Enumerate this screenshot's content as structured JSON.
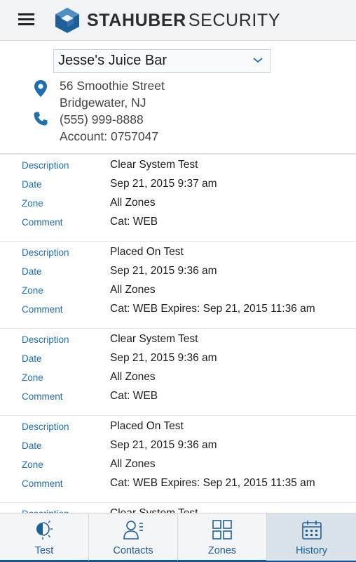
{
  "header": {
    "brand_bold": "STAHUBER",
    "brand_light": "SECURITY",
    "colors": {
      "logo_dark": "#1f5f97",
      "logo_light": "#4f8fc6"
    }
  },
  "account": {
    "site_name": "Jesse's Juice Bar",
    "street": "56 Smoothie Street",
    "city": "Bridgewater, NJ",
    "phone": "(555) 999-8888",
    "account_label": "Account: 0757047"
  },
  "history": {
    "labels": {
      "description": "Description",
      "date": "Date",
      "zone": "Zone",
      "comment": "Comment"
    },
    "records": [
      {
        "description": "Clear System Test",
        "date": "Sep 21, 2015 9:37 am",
        "zone": "All Zones",
        "comment": "Cat: WEB"
      },
      {
        "description": "Placed On Test",
        "date": "Sep 21, 2015 9:36 am",
        "zone": "All Zones",
        "comment": "Cat: WEB Expires: Sep 21, 2015 11:36 am"
      },
      {
        "description": "Clear System Test",
        "date": "Sep 21, 2015 9:36 am",
        "zone": "All Zones",
        "comment": "Cat: WEB"
      },
      {
        "description": "Placed On Test",
        "date": "Sep 21, 2015 9:36 am",
        "zone": "All Zones",
        "comment": "Cat: WEB Expires: Sep 21, 2015 11:35 am"
      },
      {
        "description": "Clear System Test",
        "date": "",
        "zone": "",
        "comment": ""
      }
    ]
  },
  "tabs": [
    {
      "label": "Test",
      "icon": "test-icon",
      "active": false
    },
    {
      "label": "Contacts",
      "icon": "contacts-icon",
      "active": false
    },
    {
      "label": "Zones",
      "icon": "zones-icon",
      "active": false
    },
    {
      "label": "History",
      "icon": "history-icon",
      "active": true
    }
  ],
  "colors": {
    "accent": "#1f6fb0",
    "tab_label": "#1f5f97",
    "active_tab_bg": "#dbe3ea",
    "bottom_bar": "#15578f"
  }
}
